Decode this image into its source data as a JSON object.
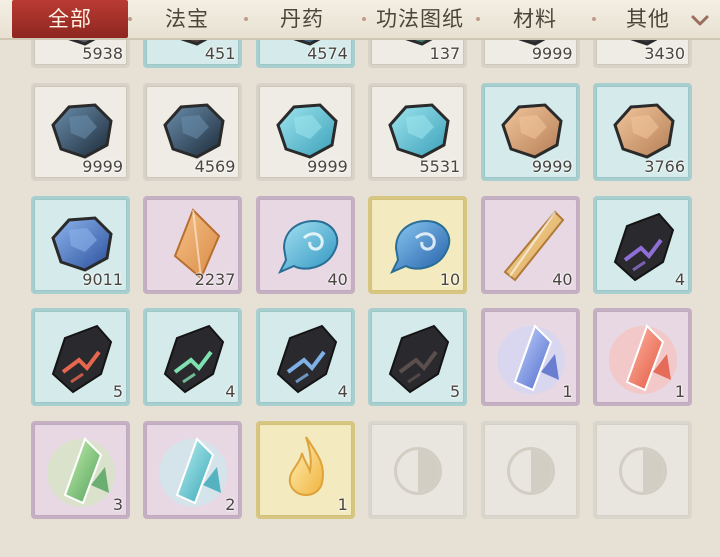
{
  "tabs": [
    {
      "label": "全部",
      "active": true
    },
    {
      "label": "法宝",
      "active": false
    },
    {
      "label": "丹药",
      "active": false
    },
    {
      "label": "功法图纸",
      "active": false
    },
    {
      "label": "材料",
      "active": false
    },
    {
      "label": "其他",
      "active": false
    }
  ],
  "more_icon": "chevron-down-icon",
  "slots": [
    {
      "tier": "white",
      "item": "gray-ore",
      "count": "5938"
    },
    {
      "tier": "blue",
      "item": "brown-ore",
      "count": "451"
    },
    {
      "tier": "blue",
      "item": "blue-ore",
      "count": "4574"
    },
    {
      "tier": "white",
      "item": "green-ore",
      "count": "137"
    },
    {
      "tier": "white",
      "item": "dark-ore",
      "count": "9999"
    },
    {
      "tier": "white",
      "item": "dark-ore",
      "count": "3430"
    },
    {
      "tier": "white",
      "item": "dark-blue-ore",
      "count": "9999"
    },
    {
      "tier": "white",
      "item": "dark-blue-ore",
      "count": "4569"
    },
    {
      "tier": "white",
      "item": "cyan-crystal-ore",
      "count": "9999"
    },
    {
      "tier": "white",
      "item": "cyan-crystal-ore",
      "count": "5531"
    },
    {
      "tier": "blue",
      "item": "amber-ore",
      "count": "9999"
    },
    {
      "tier": "blue",
      "item": "amber-ore",
      "count": "3766"
    },
    {
      "tier": "blue",
      "item": "sapphire-ore",
      "count": "9011"
    },
    {
      "tier": "purple",
      "item": "orange-gem",
      "count": "2237"
    },
    {
      "tier": "purple",
      "item": "water-drop",
      "count": "40"
    },
    {
      "tier": "gold",
      "item": "water-spirit",
      "count": "10"
    },
    {
      "tier": "purple",
      "item": "amber-shard",
      "count": "40"
    },
    {
      "tier": "blue",
      "item": "violet-vein-stone",
      "count": "4"
    },
    {
      "tier": "blue",
      "item": "red-vein-stone",
      "count": "5"
    },
    {
      "tier": "blue",
      "item": "green-vein-stone",
      "count": "4"
    },
    {
      "tier": "blue",
      "item": "blue-vein-stone",
      "count": "4"
    },
    {
      "tier": "blue",
      "item": "black-stone",
      "count": "5"
    },
    {
      "tier": "purple",
      "item": "lightning-crystal",
      "count": "1"
    },
    {
      "tier": "purple",
      "item": "fire-crystal",
      "count": "1"
    },
    {
      "tier": "purple",
      "item": "wood-crystal",
      "count": "3"
    },
    {
      "tier": "purple",
      "item": "water-crystal",
      "count": "2"
    },
    {
      "tier": "gold",
      "item": "spirit-flame",
      "count": "1"
    },
    {
      "tier": "empty",
      "item": "taiji-icon",
      "count": ""
    },
    {
      "tier": "empty",
      "item": "taiji-icon",
      "count": ""
    },
    {
      "tier": "empty",
      "item": "taiji-icon",
      "count": ""
    }
  ],
  "colors": {
    "active_tab": "#a8302a",
    "tier_white": "#efece6",
    "tier_blue": "#d5ebeb",
    "tier_purple": "#e7d8e4",
    "tier_gold": "#f3ebbf"
  }
}
